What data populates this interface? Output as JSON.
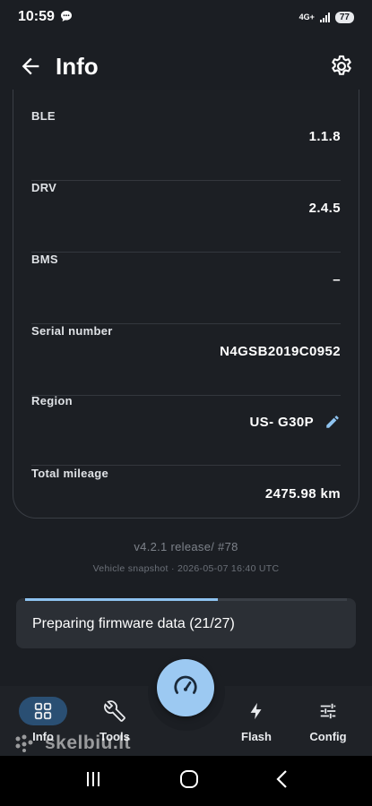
{
  "status_bar": {
    "time": "10:59",
    "network": "4G+",
    "battery": "77"
  },
  "app_bar": {
    "title": "Info"
  },
  "rows": [
    {
      "label": "BLE",
      "value": "1.1.8"
    },
    {
      "label": "DRV",
      "value": "2.4.5"
    },
    {
      "label": "BMS",
      "value": "–"
    },
    {
      "label": "Serial number",
      "value": "N4GSB2019C0952"
    },
    {
      "label": "Region",
      "value": "US- G30P"
    },
    {
      "label": "Total mileage",
      "value": "2475.98 km"
    }
  ],
  "version": "v4.2.1 release/ #78",
  "snapshot": "Vehicle snapshot · 2026-05-07 16:40 UTC",
  "progress": {
    "text": "Preparing firmware data (21/27)",
    "fraction": 0.6
  },
  "nav": {
    "items": [
      {
        "label": "Info",
        "icon": "grid-icon",
        "active": true
      },
      {
        "label": "Tools",
        "icon": "wrench-icon",
        "active": false
      },
      {
        "label": "Flash",
        "icon": "lightning-icon",
        "active": false
      },
      {
        "label": "Config",
        "icon": "sliders-icon",
        "active": false
      }
    ],
    "fab_icon": "speedometer-icon"
  },
  "watermark": "skelbiu.lt",
  "colors": {
    "accent": "#9cc9f2",
    "active_nav_bg": "#2a4f73",
    "background": "#1b1e23"
  }
}
